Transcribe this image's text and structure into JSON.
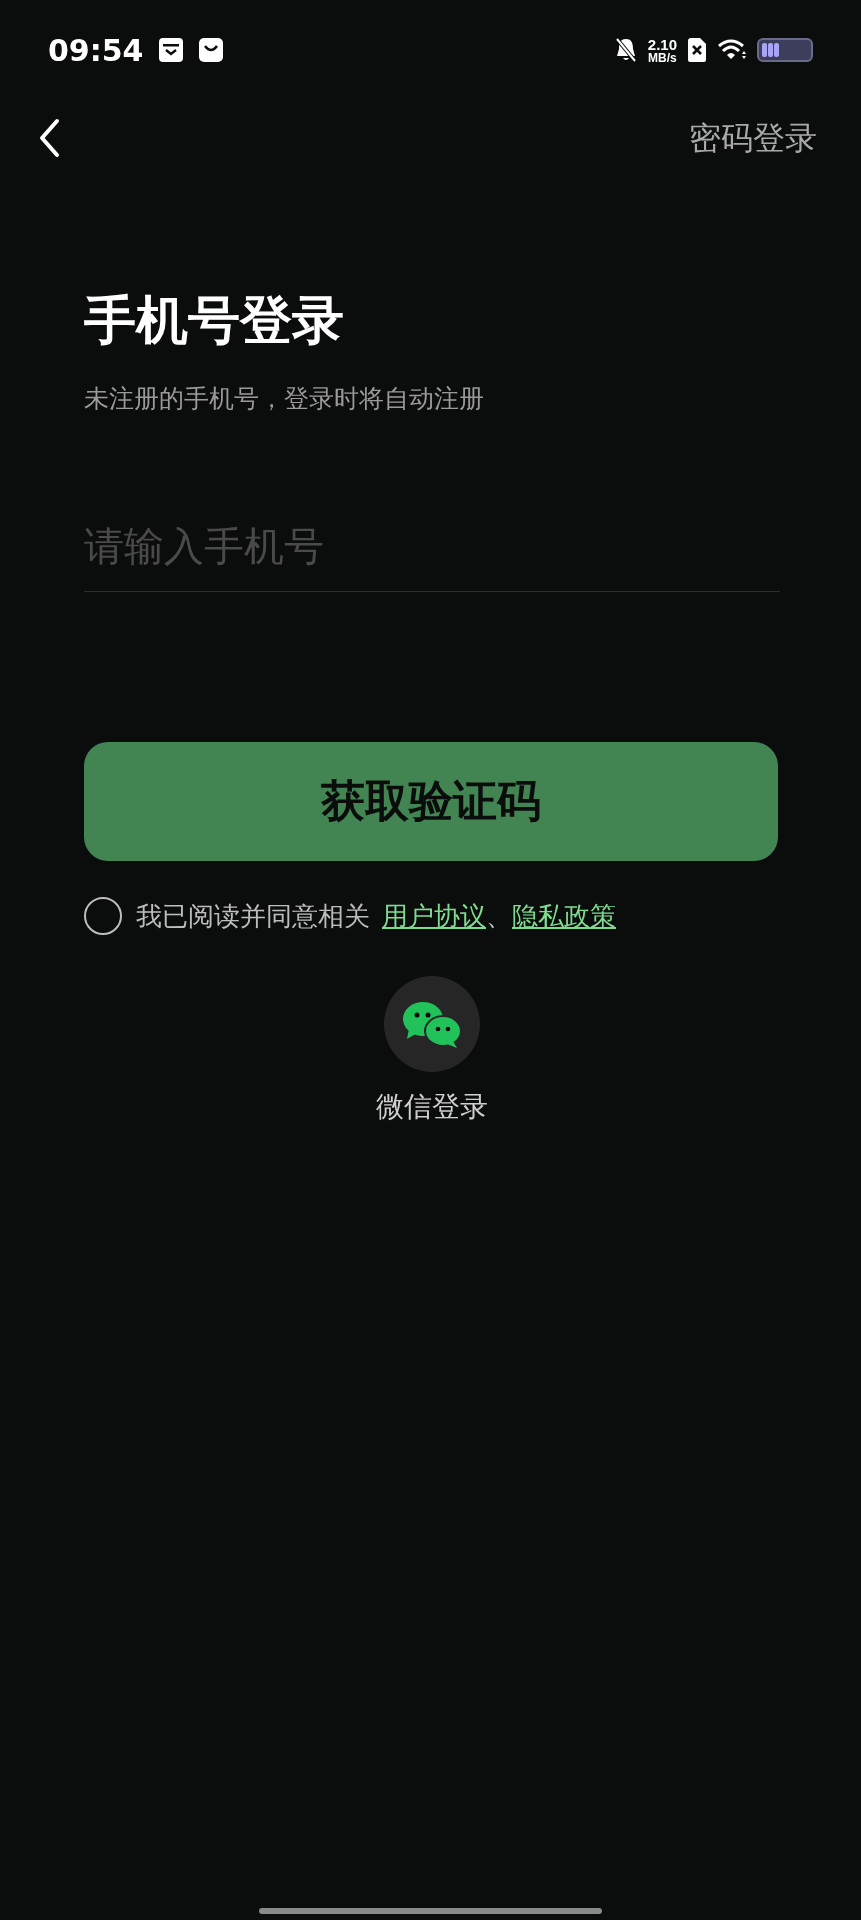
{
  "status_bar": {
    "time": "09:54",
    "speed_value": "2.10",
    "speed_unit": "MB/s"
  },
  "header": {
    "password_login": "密码登录"
  },
  "title": "手机号登录",
  "subtitle": "未注册的手机号，登录时将自动注册",
  "phone_field": {
    "placeholder": "请输入手机号"
  },
  "submit_button": "获取验证码",
  "agreement": {
    "checked": false,
    "text": "我已阅读并同意相关",
    "links": [
      "用户协议",
      "隐私政策"
    ],
    "separator": "、"
  },
  "wechat_login": {
    "label": "微信登录"
  }
}
